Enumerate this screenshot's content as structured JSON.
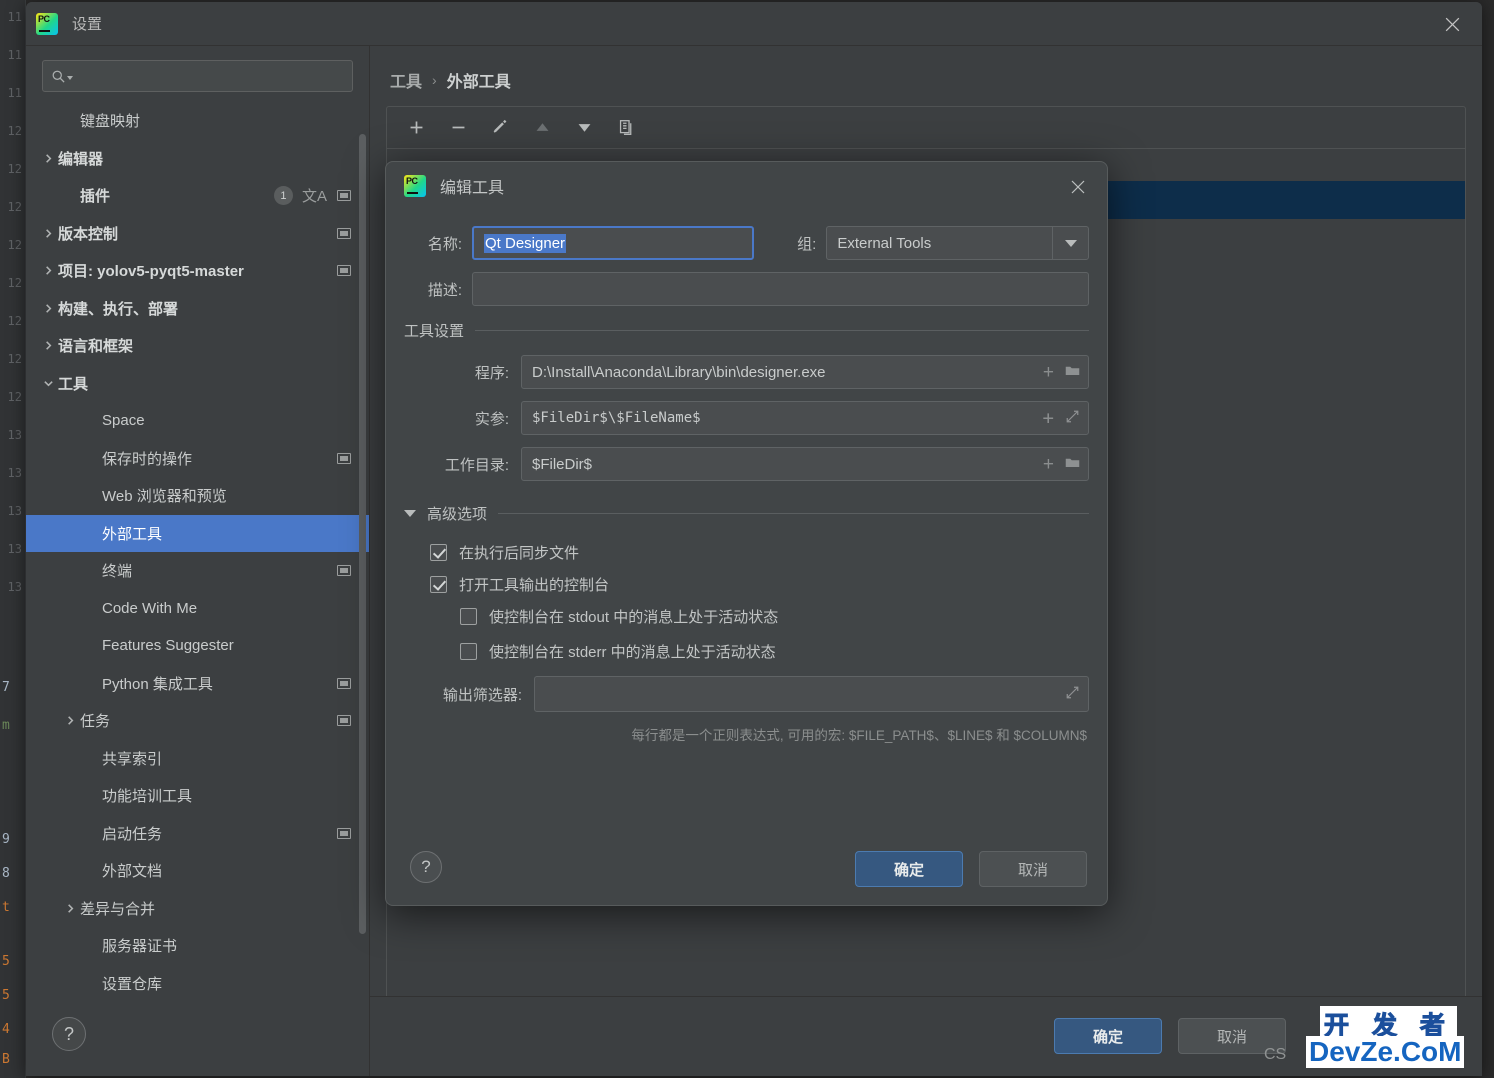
{
  "window": {
    "title": "设置",
    "logo_text": "PC",
    "close_icon": "close-icon"
  },
  "search": {
    "value": "",
    "placeholder": ""
  },
  "sidebar": {
    "items": [
      {
        "label": "键盘映射",
        "indent": 1,
        "arrow": "none",
        "bold": false,
        "selected": false,
        "badge": "",
        "translate": false,
        "window_icon": false
      },
      {
        "label": "编辑器",
        "indent": 0,
        "arrow": "right",
        "bold": true,
        "selected": false,
        "badge": "",
        "translate": false,
        "window_icon": false
      },
      {
        "label": "插件",
        "indent": 1,
        "arrow": "none",
        "bold": true,
        "selected": false,
        "badge": "1",
        "translate": true,
        "window_icon": true
      },
      {
        "label": "版本控制",
        "indent": 0,
        "arrow": "right",
        "bold": true,
        "selected": false,
        "badge": "",
        "translate": false,
        "window_icon": true
      },
      {
        "label": "项目: yolov5-pyqt5-master",
        "indent": 0,
        "arrow": "right",
        "bold": true,
        "selected": false,
        "badge": "",
        "translate": false,
        "window_icon": true
      },
      {
        "label": "构建、执行、部署",
        "indent": 0,
        "arrow": "right",
        "bold": true,
        "selected": false,
        "badge": "",
        "translate": false,
        "window_icon": false
      },
      {
        "label": "语言和框架",
        "indent": 0,
        "arrow": "right",
        "bold": true,
        "selected": false,
        "badge": "",
        "translate": false,
        "window_icon": false
      },
      {
        "label": "工具",
        "indent": 0,
        "arrow": "down",
        "bold": true,
        "selected": false,
        "badge": "",
        "translate": false,
        "window_icon": false
      },
      {
        "label": "Space",
        "indent": 2,
        "arrow": "none",
        "bold": false,
        "selected": false,
        "badge": "",
        "translate": false,
        "window_icon": false
      },
      {
        "label": "保存时的操作",
        "indent": 2,
        "arrow": "none",
        "bold": false,
        "selected": false,
        "badge": "",
        "translate": false,
        "window_icon": true
      },
      {
        "label": "Web 浏览器和预览",
        "indent": 2,
        "arrow": "none",
        "bold": false,
        "selected": false,
        "badge": "",
        "translate": false,
        "window_icon": false
      },
      {
        "label": "外部工具",
        "indent": 2,
        "arrow": "none",
        "bold": false,
        "selected": true,
        "badge": "",
        "translate": false,
        "window_icon": false
      },
      {
        "label": "终端",
        "indent": 2,
        "arrow": "none",
        "bold": false,
        "selected": false,
        "badge": "",
        "translate": false,
        "window_icon": true
      },
      {
        "label": "Code With Me",
        "indent": 2,
        "arrow": "none",
        "bold": false,
        "selected": false,
        "badge": "",
        "translate": false,
        "window_icon": false
      },
      {
        "label": "Features Suggester",
        "indent": 2,
        "arrow": "none",
        "bold": false,
        "selected": false,
        "badge": "",
        "translate": false,
        "window_icon": false
      },
      {
        "label": "Python 集成工具",
        "indent": 2,
        "arrow": "none",
        "bold": false,
        "selected": false,
        "badge": "",
        "translate": false,
        "window_icon": true
      },
      {
        "label": "任务",
        "indent": 1,
        "arrow": "right",
        "bold": false,
        "selected": false,
        "badge": "",
        "translate": false,
        "window_icon": true
      },
      {
        "label": "共享索引",
        "indent": 2,
        "arrow": "none",
        "bold": false,
        "selected": false,
        "badge": "",
        "translate": false,
        "window_icon": false
      },
      {
        "label": "功能培训工具",
        "indent": 2,
        "arrow": "none",
        "bold": false,
        "selected": false,
        "badge": "",
        "translate": false,
        "window_icon": false
      },
      {
        "label": "启动任务",
        "indent": 2,
        "arrow": "none",
        "bold": false,
        "selected": false,
        "badge": "",
        "translate": false,
        "window_icon": true
      },
      {
        "label": "外部文档",
        "indent": 2,
        "arrow": "none",
        "bold": false,
        "selected": false,
        "badge": "",
        "translate": false,
        "window_icon": false
      },
      {
        "label": "差异与合并",
        "indent": 1,
        "arrow": "right",
        "bold": false,
        "selected": false,
        "badge": "",
        "translate": false,
        "window_icon": false
      },
      {
        "label": "服务器证书",
        "indent": 2,
        "arrow": "none",
        "bold": false,
        "selected": false,
        "badge": "",
        "translate": false,
        "window_icon": false
      },
      {
        "label": "设置仓库",
        "indent": 2,
        "arrow": "none",
        "bold": false,
        "selected": false,
        "badge": "",
        "translate": false,
        "window_icon": false
      }
    ]
  },
  "content": {
    "breadcrumb": {
      "parent": "工具",
      "separator": "›",
      "current": "外部工具"
    },
    "toolbar": [
      {
        "name": "add-tool-button",
        "glyph": "plus",
        "dim": false
      },
      {
        "name": "remove-tool-button",
        "glyph": "minus",
        "dim": false
      },
      {
        "name": "edit-tool-button",
        "glyph": "pencil",
        "dim": false
      },
      {
        "name": "move-up-button",
        "glyph": "triangle-up",
        "dim": true
      },
      {
        "name": "move-down-button",
        "glyph": "triangle-down",
        "dim": false
      },
      {
        "name": "copy-tool-button",
        "glyph": "copy",
        "dim": false
      }
    ],
    "tool_group": "External Tools",
    "nav_back": "back-arrow-icon",
    "nav_forward": "forward-arrow-icon"
  },
  "main_footer": {
    "help": "?",
    "ok": "确定",
    "cancel": "取消"
  },
  "dialog": {
    "title": "编辑工具",
    "close_icon": "close-icon",
    "name_label": "名称:",
    "name_value": "Qt Designer",
    "group_label": "组:",
    "group_value": "External Tools",
    "desc_label": "描述:",
    "desc_value": "",
    "settings_section": "工具设置",
    "program_label": "程序:",
    "program_value": "D:\\Install\\Anaconda\\Library\\bin\\designer.exe",
    "arguments_label": "实参:",
    "arguments_value": "$FileDir$\\$FileName$",
    "workdir_label": "工作目录:",
    "workdir_value": "$FileDir$",
    "advanced_section": "高级选项",
    "checkboxes": [
      {
        "label": "在执行后同步文件",
        "checked": true,
        "indent": 0
      },
      {
        "label": "打开工具输出的控制台",
        "checked": true,
        "indent": 0
      },
      {
        "label": "使控制台在 stdout 中的消息上处于活动状态",
        "checked": false,
        "indent": 1
      },
      {
        "label": "使控制台在 stderr 中的消息上处于活动状态",
        "checked": false,
        "indent": 1
      }
    ],
    "filter_label": "输出筛选器:",
    "filter_value": "",
    "filter_hint": "每行都是一个正则表达式, 可用的宏: $FILE_PATH$、$LINE$ 和 $COLUMN$",
    "help": "?",
    "ok": "确定",
    "cancel": "取消"
  },
  "watermark": {
    "cs": "CS",
    "top": "开 发 者",
    "bottom": "DevZe.CoM"
  },
  "colors": {
    "accent_blue": "#4a78c8",
    "primary_button": "#365880",
    "dialog_bg": "#414547",
    "window_bg": "#3c3f41",
    "selected_row_bg": "#0d2d4a"
  }
}
